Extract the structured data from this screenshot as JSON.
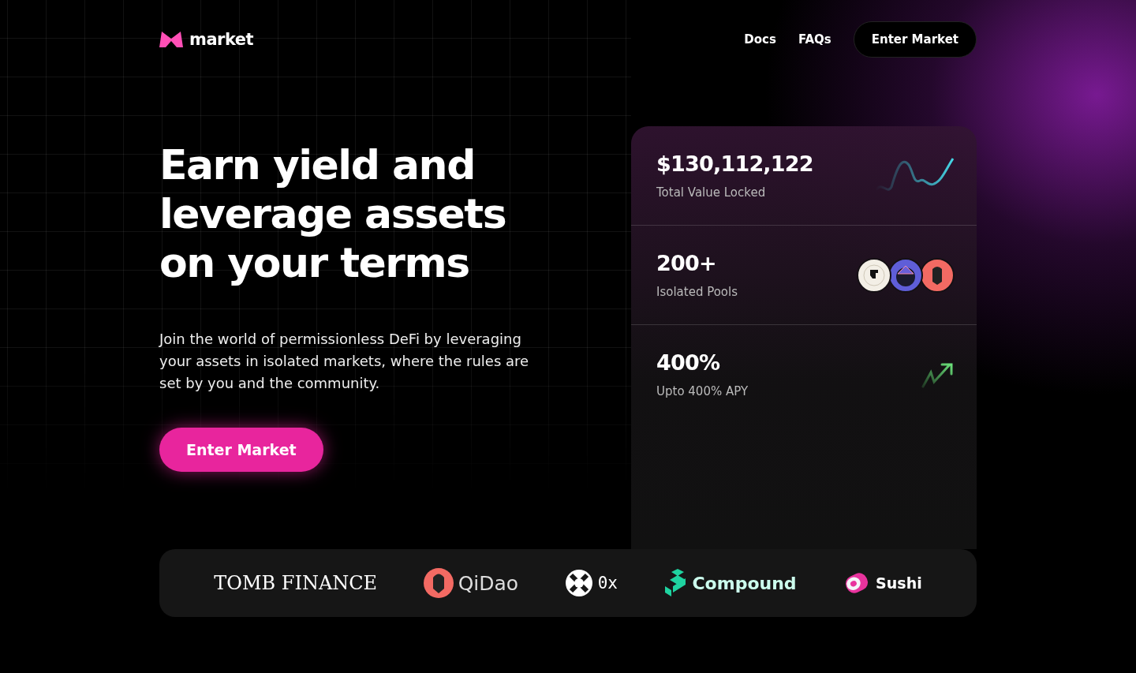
{
  "header": {
    "brand": "market",
    "nav": [
      {
        "label": "Docs"
      },
      {
        "label": "FAQs"
      }
    ],
    "cta": "Enter Market"
  },
  "hero": {
    "title_lines": [
      "Earn yield and",
      "leverage assets",
      "on your terms"
    ],
    "description": "Join the world of permissionless DeFi by leveraging your assets in isolated markets, where the rules are set by you and the community.",
    "cta": "Enter Market"
  },
  "stats": [
    {
      "kind": "sparkline",
      "value": "$130,112,122",
      "label": "Total Value Locked"
    },
    {
      "kind": "avatars",
      "value": "200+",
      "label": "Isolated Pools"
    },
    {
      "kind": "trend",
      "value": "400%",
      "label": "Upto 400% APY"
    }
  ],
  "partners": [
    {
      "kind": "tomb",
      "name": "TOMB FINANCE"
    },
    {
      "kind": "qidao",
      "name": "QiDao"
    },
    {
      "kind": "zerox",
      "name": "0x"
    },
    {
      "kind": "compound",
      "name": "Compound"
    },
    {
      "kind": "sushi",
      "name": "Sushi"
    }
  ]
}
